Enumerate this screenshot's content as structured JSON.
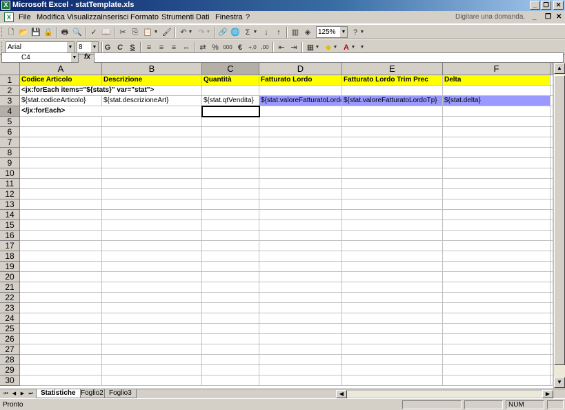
{
  "window": {
    "title": "Microsoft Excel - statTemplate.xls",
    "minimize": "_",
    "restore": "❐",
    "close": "✕"
  },
  "menu": {
    "items": [
      "File",
      "Modifica",
      "Visualizza",
      "Inserisci",
      "Formato",
      "Strumenti",
      "Dati",
      "Finestra",
      "?"
    ],
    "help_placeholder": "Digitare una domanda.",
    "mdi_minimize": "_",
    "mdi_restore": "❐",
    "mdi_close": "✕"
  },
  "toolbar": {
    "zoom": "125%",
    "font_name": "Arial",
    "font_size": "8",
    "bold": "G",
    "italic": "C",
    "underline": "S",
    "percent": "%",
    "thousands": "000",
    "currency": "€",
    "inc_decimals": "+,0",
    "dec_decimals": ",00"
  },
  "formula_bar": {
    "cell_ref": "C4",
    "fx": "fx",
    "content": ""
  },
  "sheet": {
    "columns": [
      "A",
      "B",
      "C",
      "D",
      "E",
      "F"
    ],
    "selected_column": "C",
    "rows": [
      "1",
      "2",
      "3",
      "4",
      "5",
      "6",
      "7",
      "8",
      "9",
      "10",
      "11",
      "12",
      "13",
      "14",
      "15",
      "16",
      "17",
      "18",
      "19",
      "20",
      "21",
      "22",
      "23",
      "24",
      "25",
      "26",
      "27",
      "28",
      "29",
      "30"
    ],
    "selected_row": "4",
    "active_cell": "C4",
    "header_fill": "#ffff00",
    "data_fill": "#9999ff",
    "cells": {
      "A1": "Codice Articolo",
      "B1": "Descrizione",
      "C1": "Quantità",
      "D1": "Fatturato Lordo",
      "E1": "Fatturato Lordo Trim Prec",
      "F1": "Delta",
      "A2": "<jx:forEach items=\"${stats}\" var=\"stat\">",
      "A3": "${stat.codiceArticolo}",
      "B3": "${stat.descrizioneArt}",
      "C3": "${stat.qtVendita}",
      "D3": "${stat.valoreFatturatoLordo}",
      "E3": "${stat.valoreFatturatoLordoTp}",
      "F3": "${stat.delta}",
      "A4": "</jx:forEach>"
    }
  },
  "tabs": {
    "items": [
      "Statistiche",
      "Foglio2",
      "Foglio3"
    ],
    "active": "Statistiche"
  },
  "status": {
    "text": "Pronto",
    "num": "NUM"
  }
}
